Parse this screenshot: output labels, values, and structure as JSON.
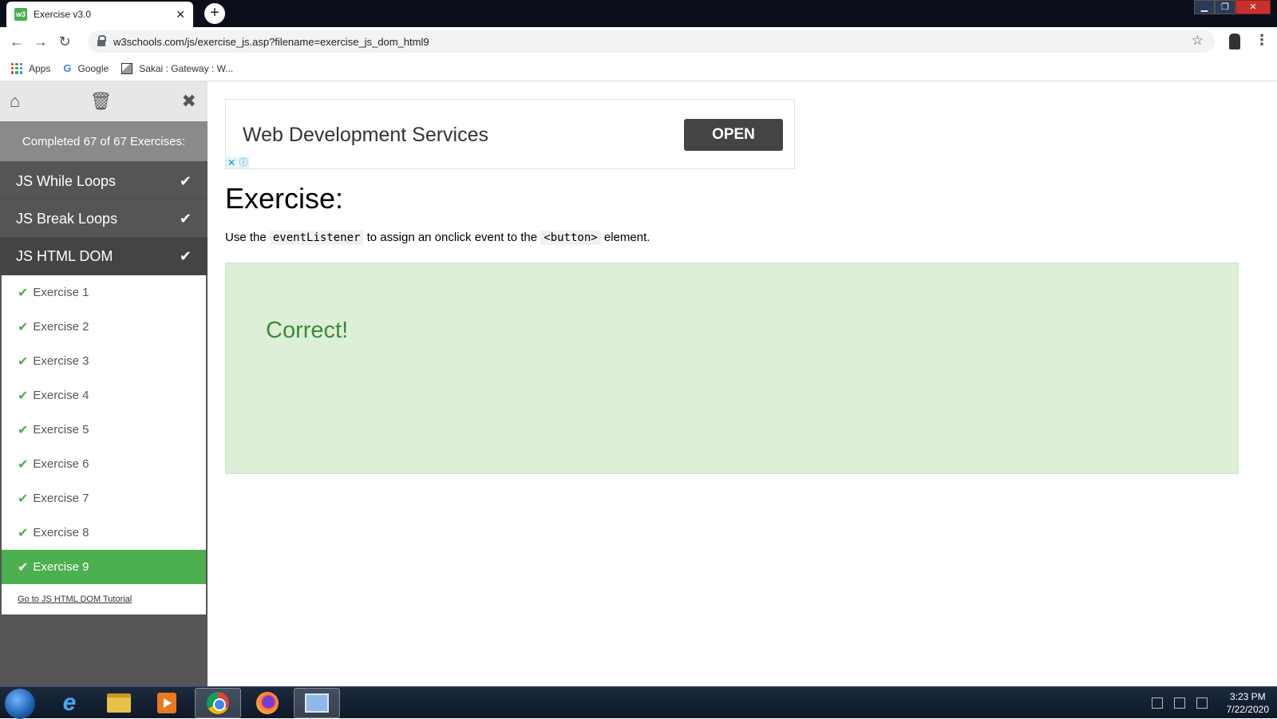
{
  "browser": {
    "tab_title": "Exercise v3.0",
    "tab_favicon": "w3",
    "url": "w3schools.com/js/exercise_js.asp?filename=exercise_js_dom_html9",
    "bookmarks": [
      {
        "label": "Apps",
        "icon": "apps-grid-icon"
      },
      {
        "label": "Google",
        "icon": "google-icon"
      },
      {
        "label": "Sakai : Gateway : W...",
        "icon": "sakai-icon"
      }
    ]
  },
  "sidebar": {
    "completed_text": "Completed 67 of 67 Exercises:",
    "sections": [
      {
        "label": "JS While Loops"
      },
      {
        "label": "JS Break Loops"
      },
      {
        "label": "JS HTML DOM"
      }
    ],
    "exercises": [
      {
        "label": "Exercise 1"
      },
      {
        "label": "Exercise 2"
      },
      {
        "label": "Exercise 3"
      },
      {
        "label": "Exercise 4"
      },
      {
        "label": "Exercise 5"
      },
      {
        "label": "Exercise 6"
      },
      {
        "label": "Exercise 7"
      },
      {
        "label": "Exercise 8"
      },
      {
        "label": "Exercise 9"
      }
    ],
    "tutorial_link": "Go to JS HTML DOM Tutorial"
  },
  "ad": {
    "title": "Web Development Services",
    "button": "OPEN"
  },
  "exercise": {
    "heading": "Exercise:",
    "text_before": "Use the ",
    "code1": "eventListener",
    "text_middle": " to assign an onclick event to the ",
    "code2": "<button>",
    "text_after": " element.",
    "result": "Correct!"
  },
  "taskbar": {
    "time": "3:23 PM",
    "date": "7/22/2020"
  },
  "colors": {
    "accent_green": "#4caf50",
    "sidebar_dark": "#555555",
    "result_bg": "#ddefd7",
    "result_text": "#3c8a3c"
  }
}
